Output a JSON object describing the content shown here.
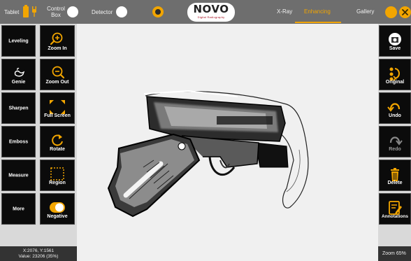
{
  "topbar": {
    "tablet_label": "Tablet",
    "control_box_label": "Control\nBox",
    "detector_label": "Detector",
    "logo_text": "NOVO",
    "logo_subtext": "Digital Radiography",
    "tabs": [
      {
        "label": "X-Ray",
        "active": false
      },
      {
        "label": "Enhancing",
        "active": true
      },
      {
        "label": "Gallery",
        "active": false
      }
    ],
    "icons": [
      "battery-icon",
      "power-plug-icon",
      "camera-icon",
      "settings-icon",
      "close-icon"
    ]
  },
  "left_tools": {
    "col1": [
      {
        "label": "Leveling",
        "icon": null
      },
      {
        "label": "Genie",
        "icon": "genie-lamp-icon"
      },
      {
        "label": "Sharpen",
        "icon": null
      },
      {
        "label": "Emboss",
        "icon": null
      },
      {
        "label": "Measure",
        "icon": null
      },
      {
        "label": "More",
        "icon": null
      }
    ],
    "col2": [
      {
        "label": "Zoom In",
        "icon": "zoom-in-icon"
      },
      {
        "label": "Zoom Out",
        "icon": "zoom-out-icon"
      },
      {
        "label": "Full Screen",
        "icon": "fullscreen-icon"
      },
      {
        "label": "Rotate",
        "icon": "rotate-icon"
      },
      {
        "label": "Region",
        "icon": "region-select-icon"
      },
      {
        "label": "Negative",
        "icon": "negative-toggle-icon"
      }
    ]
  },
  "right_tools": [
    {
      "label": "Save",
      "icon": "save-icon",
      "enabled": true
    },
    {
      "label": "Original",
      "icon": "original-icon",
      "enabled": true
    },
    {
      "label": "Undo",
      "icon": "undo-icon",
      "enabled": true
    },
    {
      "label": "Redo",
      "icon": "redo-icon",
      "enabled": false
    },
    {
      "label": "Delete",
      "icon": "trash-icon",
      "enabled": true
    },
    {
      "label": "Annotations",
      "icon": "annotations-icon",
      "enabled": true
    }
  ],
  "status": {
    "coords": "X:2076, Y:1561",
    "value": "Value: 23206 (35%)",
    "zoom": "Zoom 65%"
  },
  "colors": {
    "accent": "#f2a500",
    "topbar_bg": "#6e6e6e",
    "tile_bg": "#0b0b0b",
    "viewer_bg": "#f0f0f0"
  }
}
